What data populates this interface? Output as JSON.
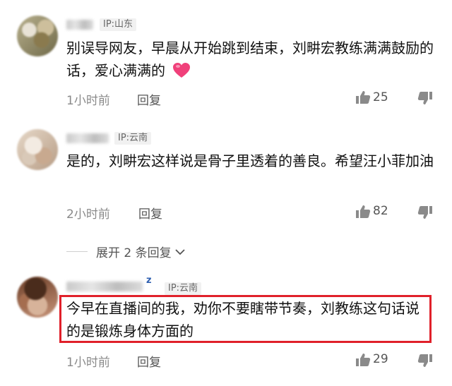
{
  "comments": [
    {
      "ip": "IP:山东",
      "text": "别误导网友，早晨从开始跳到结束，刘畊宏教练满满鼓励的话，爱心满满的",
      "time": "1小时前",
      "reply_label": "回复",
      "likes": "25"
    },
    {
      "ip": "IP:云南",
      "text": "是的，刘畊宏这样说是骨子里透着的善良。希望汪小菲加油",
      "time": "2小时前",
      "reply_label": "回复",
      "likes": "82",
      "expand_label": "展开 2 条回复"
    },
    {
      "name_suffix": "z",
      "ip": "IP:云南",
      "text": "今早在直播间的我，劝你不要瞎带节奏，刘教练这句话说的是锻炼身体方面的",
      "time": "1小时前",
      "reply_label": "回复",
      "likes": "29"
    }
  ],
  "icons": {
    "like": "thumbs-up-icon",
    "dislike": "thumbs-down-icon",
    "heart": "heart-icon",
    "expand": "chevron-down-icon"
  },
  "colors": {
    "highlight_border": "#e0202a",
    "heart": "#f0407a",
    "link_blue": "#2f5fb0"
  }
}
